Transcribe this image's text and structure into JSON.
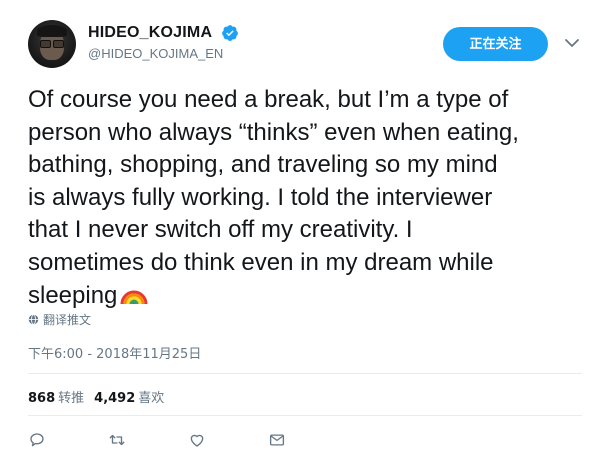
{
  "tweet": {
    "display_name": "HIDEO_KOJIMA",
    "handle": "@HIDEO_KOJIMA_EN",
    "follow_label": "正在关注",
    "text": "Of course you need a break, but I’m a type of\nperson who always “thinks” even when eating,\nbathing, shopping, and traveling so my mind\nis always fully working. I told the interviewer\nthat I never switch off my creativity. I\nsometimes do think even in my dream while\nsleeping",
    "translate_label": "翻译推文",
    "timestamp": "下午6:00 - 2018年11月25日",
    "retweets": {
      "count": "868",
      "label": "转推"
    },
    "likes": {
      "count": "4,492",
      "label": "喜欢"
    }
  },
  "icons": {
    "verified": "verified-badge-icon",
    "menu": "chevron-down-icon",
    "emoji": "rainbow-icon",
    "translate": "globe-icon",
    "reply": "reply-icon",
    "retweet": "retweet-icon",
    "like": "heart-icon",
    "message": "envelope-icon"
  },
  "colors": {
    "accent": "#1da1f2",
    "text": "#14171a",
    "muted": "#657786",
    "divider": "#e6ecf0"
  }
}
